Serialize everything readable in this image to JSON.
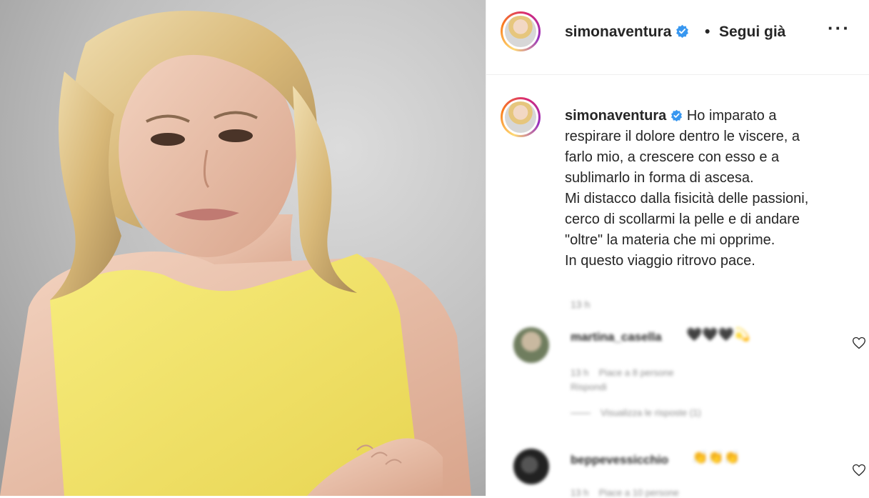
{
  "header": {
    "username": "simonaventura",
    "separator": "•",
    "follow_status": "Segui già",
    "more_label": "···"
  },
  "caption": {
    "username": "simonaventura",
    "lines": [
      "Ho imparato a",
      "respirare il dolore dentro le viscere, a",
      "farlo mio, a crescere con esso e a",
      "sublimarlo in forma di ascesa.",
      "Mi distacco dalla fisicità delle passioni,",
      "cerco di scollarmi la pelle e di andare",
      "\"oltre\" la materia che mi opprime.",
      "In questo viaggio ritrovo pace."
    ],
    "time": "13 h"
  },
  "comments": [
    {
      "username": "martina_casella",
      "reaction": "🖤🖤🖤💫",
      "time": "13 h",
      "likes": "Piace a 8 persone",
      "reply_label": "Rispondi",
      "view_replies": "Visualizza le risposte (1)"
    },
    {
      "username": "beppevessicchio",
      "reaction": "👏👏👏",
      "time": "13 h",
      "likes": "Piace a 10 persone"
    }
  ],
  "icons": {
    "verified": "verified-badge-icon",
    "more": "more-options-icon",
    "like": "heart-outline-icon"
  },
  "colors": {
    "verified_blue": "#3897f0",
    "text": "#262626",
    "muted": "#8e8e8e",
    "dress_yellow": "#f3e46a"
  }
}
